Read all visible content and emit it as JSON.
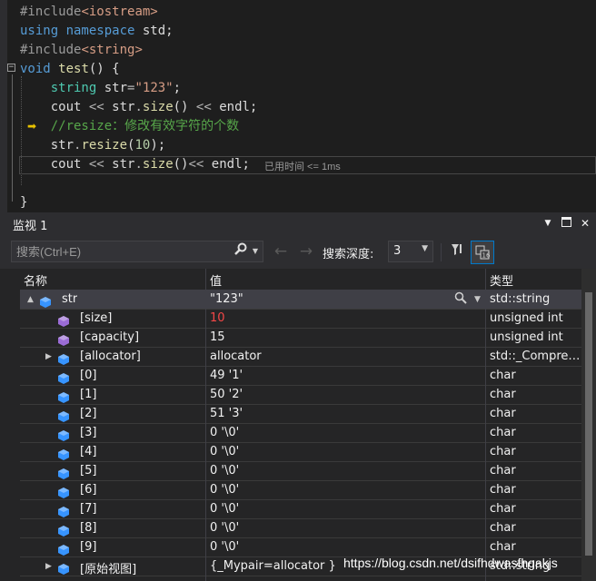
{
  "editor": {
    "lines": [
      {
        "tokens": [
          {
            "t": "#include",
            "c": "pp"
          },
          {
            "t": "<iostream>",
            "c": "str"
          }
        ]
      },
      {
        "tokens": [
          {
            "t": "using ",
            "c": "kw"
          },
          {
            "t": "namespace ",
            "c": "kw"
          },
          {
            "t": "std;",
            "c": "plain"
          }
        ]
      },
      {
        "tokens": [
          {
            "t": "#include",
            "c": "pp"
          },
          {
            "t": "<string>",
            "c": "str"
          }
        ]
      },
      {
        "tokens": [
          {
            "t": "void ",
            "c": "kw"
          },
          {
            "t": "test",
            "c": "fn"
          },
          {
            "t": "() {",
            "c": "plain"
          }
        ]
      },
      {
        "tokens": [
          {
            "t": "    "
          },
          {
            "t": "string ",
            "c": "ty"
          },
          {
            "t": "str",
            "c": "plain"
          },
          {
            "t": "=",
            "c": "op"
          },
          {
            "t": "\"123\"",
            "c": "str"
          },
          {
            "t": ";",
            "c": "plain"
          }
        ]
      },
      {
        "tokens": [
          {
            "t": "    "
          },
          {
            "t": "cout ",
            "c": "plain"
          },
          {
            "t": "<< ",
            "c": "op"
          },
          {
            "t": "str",
            "c": "plain"
          },
          {
            "t": ".",
            "c": "op"
          },
          {
            "t": "size",
            "c": "fn"
          },
          {
            "t": "() ",
            "c": "plain"
          },
          {
            "t": "<< ",
            "c": "op"
          },
          {
            "t": "endl;",
            "c": "plain"
          }
        ]
      },
      {
        "tokens": [
          {
            "t": "    "
          },
          {
            "t": "//resize：修改有效字符的个数",
            "c": "cm"
          }
        ]
      },
      {
        "tokens": [
          {
            "t": "    "
          },
          {
            "t": "str",
            "c": "plain"
          },
          {
            "t": ".",
            "c": "op"
          },
          {
            "t": "resize",
            "c": "fn"
          },
          {
            "t": "(",
            "c": "plain"
          },
          {
            "t": "10",
            "c": "num"
          },
          {
            "t": ");",
            "c": "plain"
          }
        ]
      },
      {
        "tokens": [
          {
            "t": "    "
          },
          {
            "t": "cout ",
            "c": "plain"
          },
          {
            "t": "<< ",
            "c": "op"
          },
          {
            "t": "str",
            "c": "plain"
          },
          {
            "t": ".",
            "c": "op"
          },
          {
            "t": "size",
            "c": "fn"
          },
          {
            "t": "()",
            "c": "plain"
          },
          {
            "t": "<< ",
            "c": "op"
          },
          {
            "t": "endl;",
            "c": "plain"
          }
        ]
      },
      {
        "tokens": []
      },
      {
        "tokens": [
          {
            "t": "}",
            "c": "plain"
          }
        ]
      }
    ],
    "perf_tip": "已用时间 <= 1ms"
  },
  "panel": {
    "title": "监视 1",
    "search_placeholder": "搜索(Ctrl+E)",
    "depth_label": "搜索深度:",
    "depth_value": "3",
    "columns": {
      "name": "名称",
      "value": "值",
      "type": "类型"
    },
    "rows": [
      {
        "name": "str",
        "value": "\"123\"",
        "type": "std::string",
        "level": 0,
        "expander": "▲",
        "icon": "blue-object-icon",
        "selected": true
      },
      {
        "name": "[size]",
        "value": "10",
        "type": "unsigned int",
        "level": 1,
        "expander": "",
        "icon": "purple-member-icon",
        "changed": true
      },
      {
        "name": "[capacity]",
        "value": "15",
        "type": "unsigned int",
        "level": 1,
        "expander": "",
        "icon": "purple-member-icon"
      },
      {
        "name": "[allocator]",
        "value": "allocator",
        "type": "std::_Compre…",
        "level": 1,
        "expander": "▶",
        "icon": "blue-object-icon"
      },
      {
        "name": "[0]",
        "value": "49 '1'",
        "type": "char",
        "level": 1,
        "expander": "",
        "icon": "blue-object-icon"
      },
      {
        "name": "[1]",
        "value": "50 '2'",
        "type": "char",
        "level": 1,
        "expander": "",
        "icon": "blue-object-icon"
      },
      {
        "name": "[2]",
        "value": "51 '3'",
        "type": "char",
        "level": 1,
        "expander": "",
        "icon": "blue-object-icon"
      },
      {
        "name": "[3]",
        "value": "0 '\\0'",
        "type": "char",
        "level": 1,
        "expander": "",
        "icon": "blue-object-icon"
      },
      {
        "name": "[4]",
        "value": "0 '\\0'",
        "type": "char",
        "level": 1,
        "expander": "",
        "icon": "blue-object-icon"
      },
      {
        "name": "[5]",
        "value": "0 '\\0'",
        "type": "char",
        "level": 1,
        "expander": "",
        "icon": "blue-object-icon"
      },
      {
        "name": "[6]",
        "value": "0 '\\0'",
        "type": "char",
        "level": 1,
        "expander": "",
        "icon": "blue-object-icon"
      },
      {
        "name": "[7]",
        "value": "0 '\\0'",
        "type": "char",
        "level": 1,
        "expander": "",
        "icon": "blue-object-icon"
      },
      {
        "name": "[8]",
        "value": "0 '\\0'",
        "type": "char",
        "level": 1,
        "expander": "",
        "icon": "blue-object-icon"
      },
      {
        "name": "[9]",
        "value": "0 '\\0'",
        "type": "char",
        "level": 1,
        "expander": "",
        "icon": "blue-object-icon"
      },
      {
        "name": "[原始视图]",
        "value": "{_Mypair=allocator }",
        "type": "std::string",
        "level": 1,
        "expander": "▶",
        "icon": "blue-object-icon"
      }
    ]
  },
  "watermark": "https://blog.csdn.net/dsifhdwasfhgakjs",
  "colors": {
    "changed_value": "#f44747",
    "accent": "#007acc",
    "object_icon": "#3794ff",
    "member_icon": "#9b6cd6"
  }
}
